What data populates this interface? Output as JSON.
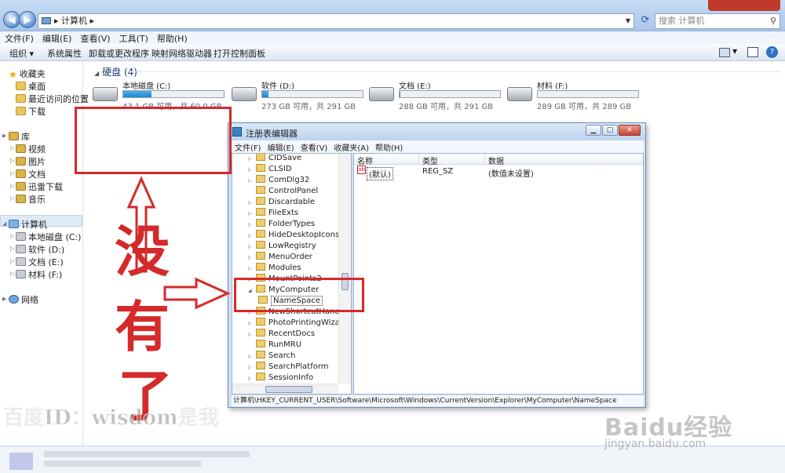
{
  "explorer": {
    "address_path": "计算机",
    "search_placeholder": "搜索 计算机",
    "menu": [
      "文件(F)",
      "编辑(E)",
      "查看(V)",
      "工具(T)",
      "帮助(H)"
    ],
    "toolbar": [
      "组织 ▾",
      "系统属性",
      "卸载或更改程序",
      "映射网络驱动器",
      "打开控制面板"
    ],
    "nav": {
      "favorites": "收藏夹",
      "desktop": "桌面",
      "recent": "最近访问的位置",
      "downloads": "下载",
      "libraries": "库",
      "videos": "视频",
      "pictures": "图片",
      "documents": "文档",
      "xunlei": "迅雷下载",
      "music": "音乐",
      "computer": "计算机",
      "drive_c": "本地磁盘 (C:)",
      "drive_d": "软件 (D:)",
      "drive_e": "文档 (E:)",
      "drive_f": "材料 (F:)",
      "network": "网络"
    },
    "section_title": "硬盘 (4)",
    "drives": [
      {
        "name": "本地磁盘 (C:)",
        "space": "43.1 GB 可用，共 60.0 GB",
        "used_fraction": 0.28
      },
      {
        "name": "软件 (D:)",
        "space": "273 GB 可用，共 291 GB",
        "used_fraction": 0.06
      },
      {
        "name": "文档 (E:)",
        "space": "288 GB 可用，共 291 GB",
        "used_fraction": 0.01
      },
      {
        "name": "材料 (F:)",
        "space": "289 GB 可用，共 289 GB",
        "used_fraction": 0.0
      }
    ]
  },
  "regedit": {
    "title": "注册表编辑器",
    "menu": [
      "文件(F)",
      "编辑(E)",
      "查看(V)",
      "收藏夹(A)",
      "帮助(H)"
    ],
    "tree": [
      "CIDSave",
      "CLSID",
      "ComDlg32",
      "ControlPanel",
      "Discardable",
      "FileExts",
      "FolderTypes",
      "HideDesktopIcons",
      "LowRegistry",
      "MenuOrder",
      "Modules",
      "MountPoints2",
      "MyComputer",
      "NameSpace",
      "NewShortcutHandlers",
      "PhotoPrintingWizard",
      "RecentDocs",
      "RunMRU",
      "Search",
      "SearchPlatform",
      "SessionInfo"
    ],
    "columns": {
      "name": "名称",
      "type": "类型",
      "data": "数据"
    },
    "value": {
      "name": "(默认)",
      "type": "REG_SZ",
      "data": "(数值未设置)"
    },
    "status": "计算机\\HKEY_CURRENT_USER\\Software\\Microsoft\\Windows\\CurrentVersion\\Explorer\\MyComputer\\NameSpace"
  },
  "annotation": {
    "char1": "没",
    "char2": "有",
    "char3": "了",
    "color": "#d42a2a"
  },
  "watermark": {
    "text": "百度ID：wisdom是我",
    "logo": "Baidu经验",
    "url": "jingyan.baidu.com"
  }
}
